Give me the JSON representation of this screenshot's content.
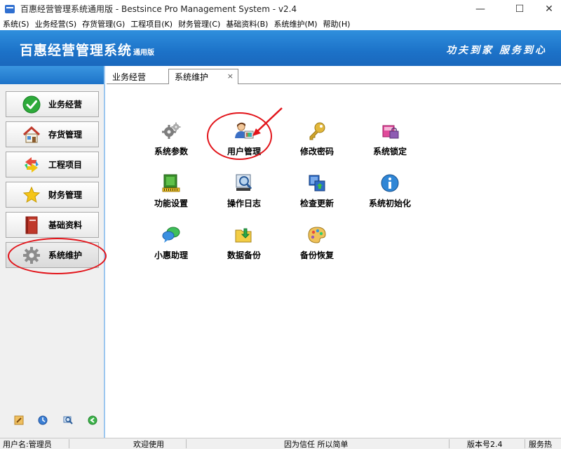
{
  "window": {
    "title": "百惠经营管理系统通用版 - Bestsince Pro Management System - v2.4",
    "minimize_glyph": "—",
    "maximize_glyph": "☐",
    "close_glyph": "✕"
  },
  "menu": [
    "系统(S)",
    "业务经营(S)",
    "存货管理(G)",
    "工程项目(K)",
    "财务管理(C)",
    "基础资料(B)",
    "系统维护(M)",
    "帮助(H)"
  ],
  "banner": {
    "app_name": "百惠经营管理系统",
    "edition": "通用版",
    "slogan": "功夫到家 服务到心",
    "colors": {
      "banner_top": "#2f8fdd",
      "banner_bottom": "#1a68bd",
      "annotation": "#e2141a"
    }
  },
  "nav": [
    {
      "label": "业务经营",
      "icon": "check-circle-icon"
    },
    {
      "label": "存货管理",
      "icon": "house-icon"
    },
    {
      "label": "工程项目",
      "icon": "arrows-cycle-icon"
    },
    {
      "label": "财务管理",
      "icon": "star-icon"
    },
    {
      "label": "基础资料",
      "icon": "book-icon"
    },
    {
      "label": "系统维护",
      "icon": "gear-icon",
      "active": true
    }
  ],
  "tabs": [
    {
      "label": "业务经营"
    },
    {
      "label": "系统维护",
      "active": true,
      "close": "×"
    }
  ],
  "functions": [
    {
      "label": "系统参数",
      "icon": "gears-icon"
    },
    {
      "label": "用户管理",
      "icon": "user-icon"
    },
    {
      "label": "修改密码",
      "icon": "key-icon"
    },
    {
      "label": "系统锁定",
      "icon": "lock-icon"
    },
    {
      "label": "功能设置",
      "icon": "settings-board-icon"
    },
    {
      "label": "操作日志",
      "icon": "magnifier-log-icon"
    },
    {
      "label": "检查更新",
      "icon": "update-icon"
    },
    {
      "label": "系统初始化",
      "icon": "info-icon"
    },
    {
      "label": "小惠助理",
      "icon": "chat-bubble-icon"
    },
    {
      "label": "数据备份",
      "icon": "folder-download-icon"
    },
    {
      "label": "备份恢复",
      "icon": "palette-icon"
    }
  ],
  "status": {
    "user": "用户名:管理员",
    "welcome": "欢迎使用",
    "motto": "因为信任 所以简单",
    "version": "版本号2.4",
    "service": "服务热"
  }
}
